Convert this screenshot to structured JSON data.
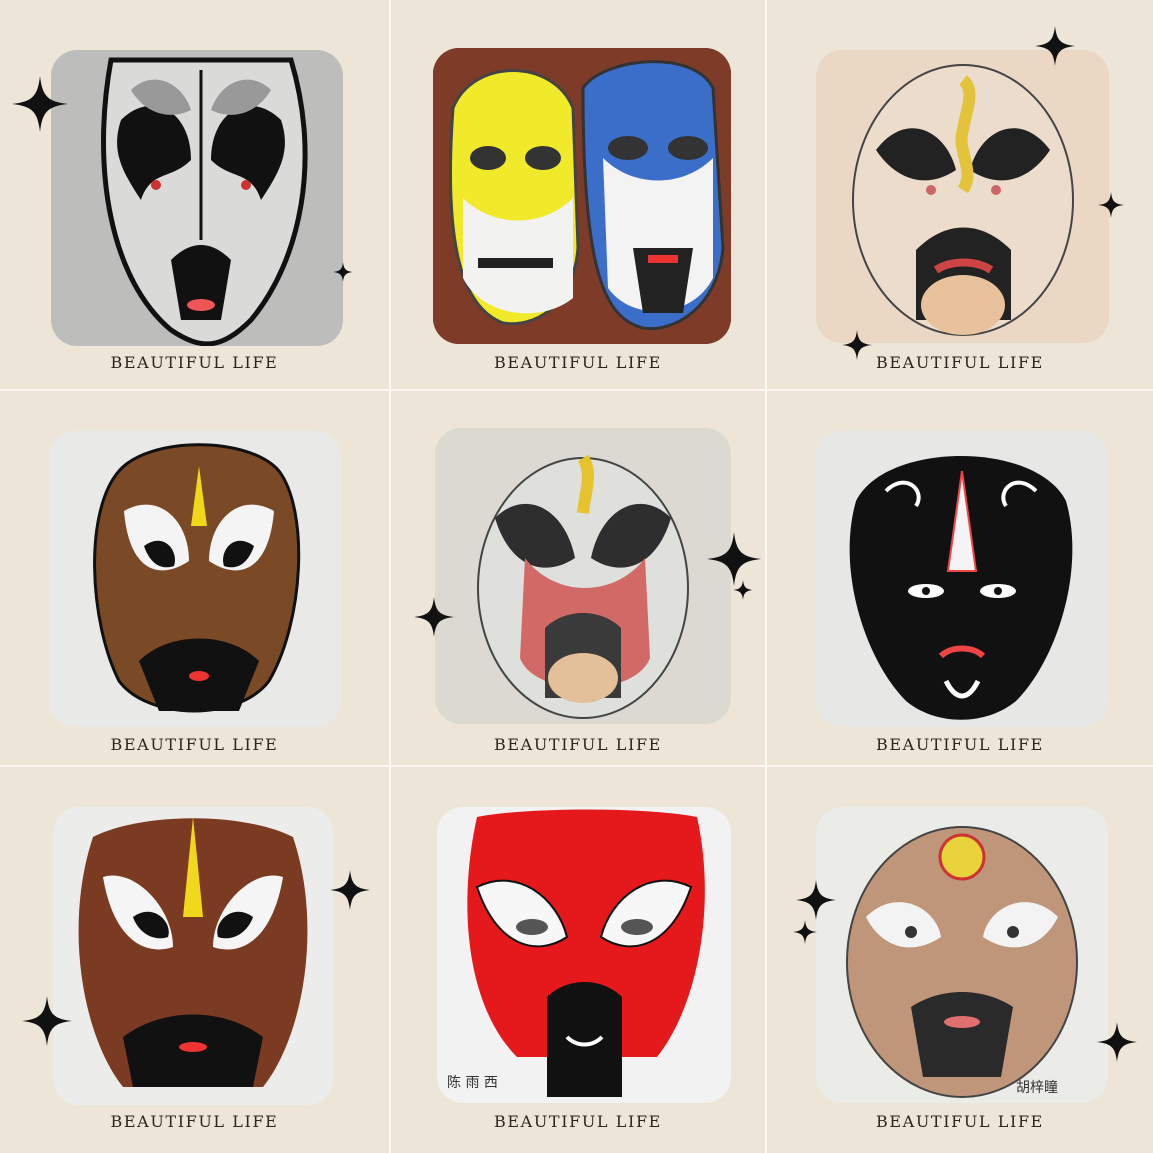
{
  "captions": [
    "BEAUTIFUL LIFE",
    "BEAUTIFUL LIFE",
    "BEAUTIFUL LIFE",
    "BEAUTIFUL LIFE",
    "BEAUTIFUL LIFE",
    "BEAUTIFUL LIFE",
    "BEAUTIFUL LIFE",
    "BEAUTIFUL LIFE",
    "BEAUTIFUL LIFE"
  ],
  "handwriting": {
    "artwork_8_text": "陈 雨 西",
    "artwork_9_signature": "胡梓瞳"
  },
  "colors": {
    "background": "#ede6d8",
    "grid_line": "#fbf8f2",
    "caption_text": "#2b2520",
    "sparkle": "#111111"
  }
}
